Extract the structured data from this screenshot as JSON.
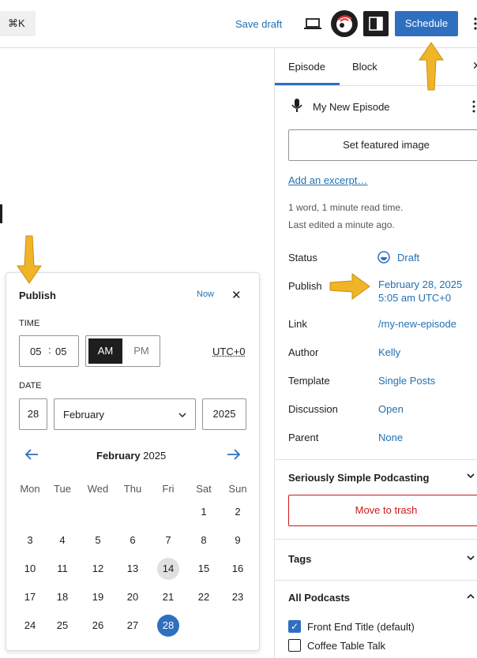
{
  "topbar": {
    "command_shortcut": "⌘K",
    "save_draft_label": "Save draft",
    "schedule_label": "Schedule"
  },
  "sidebar": {
    "tabs": [
      {
        "label": "Episode"
      },
      {
        "label": "Block"
      }
    ],
    "post_title": "My New Episode",
    "featured_image_label": "Set featured image",
    "excerpt_link": "Add an excerpt…",
    "word_count": "1 word, 1 minute read time.",
    "last_edited": "Last edited a minute ago.",
    "rows": {
      "status_label": "Status",
      "status_value": "Draft",
      "publish_label": "Publish",
      "publish_value_date": "February 28, 2025",
      "publish_value_time": "5:05 am UTC+0",
      "link_label": "Link",
      "link_value": "/my-new-episode",
      "author_label": "Author",
      "author_value": "Kelly",
      "template_label": "Template",
      "template_value": "Single Posts",
      "discussion_label": "Discussion",
      "discussion_value": "Open",
      "parent_label": "Parent",
      "parent_value": "None"
    },
    "podcasting_panel_title": "Seriously Simple Podcasting",
    "move_to_trash_label": "Move to trash",
    "tags_panel_title": "Tags",
    "podcasts_panel_title": "All Podcasts",
    "podcasts": [
      {
        "label": "Front End Title (default)",
        "checked": true
      },
      {
        "label": "Coffee Table Talk",
        "checked": false
      }
    ]
  },
  "popover": {
    "title": "Publish",
    "now_label": "Now",
    "time_label": "TIME",
    "hours": "05",
    "minutes": "05",
    "am_label": "AM",
    "pm_label": "PM",
    "timezone": "UTC+0",
    "date_label": "DATE",
    "day": "28",
    "month": "February",
    "year": "2025",
    "calendar_month": "February",
    "calendar_year": "2025",
    "weekdays": [
      "Mon",
      "Tue",
      "Wed",
      "Thu",
      "Fri",
      "Sat",
      "Sun"
    ],
    "today": 14,
    "selected": 28
  },
  "colors": {
    "accent": "#2f6fbf",
    "annotation_arrow": "#f0b429"
  }
}
